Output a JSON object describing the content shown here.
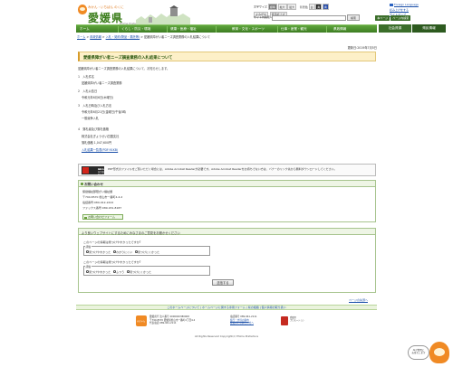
{
  "header": {
    "logo_kana": "みかん・いちばん のくに",
    "logo_name": "愛媛県",
    "logo_en": "Ehime Prefecture",
    "font_size_label": "文字サイズ",
    "font_sizes": [
      "標準",
      "拡大",
      "最大"
    ],
    "bg_color_label": "背景色",
    "bg_colors": [
      "白",
      "黒",
      "青"
    ],
    "links": [
      "よみがな",
      "音声読上げ",
      "Foreign Language"
    ],
    "read_aloud": "読み上げをする",
    "sitemap": "サイトマップ",
    "site_search_label": "サイト内検索",
    "search_button": "検索",
    "page_buttons": [
      "本ページ",
      "ページ内検索"
    ]
  },
  "nav": {
    "items": [
      "ホーム",
      "くらし・防災・環境",
      "健康・医療・福祉",
      "教育・文化・スポーツ",
      "仕事・産業・観光",
      "県政情報"
    ],
    "extra": [
      "社会資源",
      "県民情報"
    ]
  },
  "breadcrumb": {
    "items": [
      "ホーム",
      "県政情報",
      "入札・契約(物品・委託等)",
      "愛媛県障がい者ニーズ調査業務の入札結果について"
    ]
  },
  "updated": "更新日:2019年7月5日",
  "title": "愛媛県障がい者ニーズ調査業務の入札結果について",
  "body": {
    "intro": "愛媛県障がい者ニーズ調査業務の入札結果について、お知らせします。",
    "sections": [
      {
        "num": "1",
        "label": "入札件名",
        "value": "愛媛県障がい者ニーズ調査業務"
      },
      {
        "num": "2",
        "label": "入札公告日",
        "value": "令和元年6月6日(木曜日)"
      },
      {
        "num": "3",
        "label": "入札日時及び入札方法",
        "value": "令和元年6月21日(金曜日)午後3時",
        "value2": "一般競争入札"
      },
      {
        "num": "4",
        "label": "落札者及び落札価格",
        "value": "株式会社ぎょうせい四国支社",
        "value2": "落札価格 1,047,600円"
      }
    ],
    "pdf_link": "入札結果一覧表(PDF:91KB)"
  },
  "pdf_notice": {
    "logo_line1": "Get",
    "logo_line2": "Adobe Acrobat Reader",
    "text": "PDF形式のファイルをご覧いただく場合には、Adobe Acrobat Readerが必要です。Adobe Acrobat Readerをお持ちでない方は、バナーのリンク先から無料ダウンロードしてください。"
  },
  "contact": {
    "heading": "お問い合わせ",
    "lines": [
      "保健福祉部障がい福祉課",
      "〒790-8570 松山市一番町4-4-2",
      "電話番号:089-912-2422",
      "ファックス番号:089-931-8187"
    ],
    "button": "お問い合わせフォーム"
  },
  "survey": {
    "heading": "より良いウェブサイトにするためにみなさまのご意見をお聞かせください",
    "q1": "このページの情報は見つけやすかったですか?",
    "q1_legend": "評価",
    "q1_options": [
      "見つけやすかった",
      "わかりにくい",
      "見つけにくかった"
    ],
    "q2": "このページの情報は見つけやすかったですか?",
    "q2_legend": "評価",
    "q2_options": [
      "見つけやすかった",
      "ふつう",
      "見つけにくかった"
    ],
    "submit": "送信する"
  },
  "pagetop": "ページの先頭へ",
  "footer": {
    "links": "このホームページについて | ホームページに関する専用フォーム | 県の組織 | 個人情報の取り扱い",
    "mascot_label": "みきゃん",
    "addr": [
      "愛媛県庁 法人番号 4000020380008",
      "〒790-8570 愛媛県松山市一番町4丁目4-2",
      "代表電話 089-941-2111"
    ],
    "addr2": [
      "電話番号 089-941-2111",
      "県庁・支局の案内",
      "愛媛県にお越しの方へ"
    ],
    "badge_text": [
      "愛媛県",
      "プロモーション"
    ],
    "copyright": "All Rights Reserved Copyright(c) Ehime Prefecture"
  },
  "chatbot": {
    "text": [
      "AIが質問に",
      "お答えします"
    ]
  }
}
